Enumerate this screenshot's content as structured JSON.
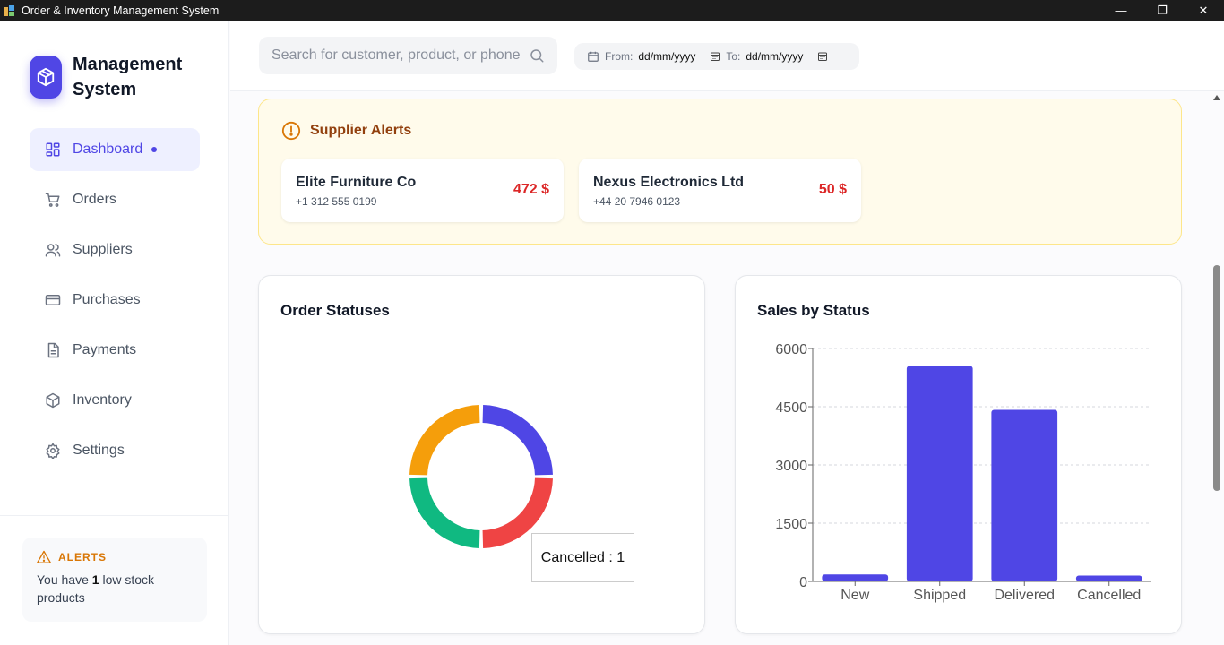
{
  "window": {
    "title": "Order & Inventory Management System",
    "controls": {
      "minimize": "—",
      "maximize": "❐",
      "close": "✕"
    }
  },
  "brand": {
    "name": "Management System",
    "icon": "box-icon"
  },
  "sidebar": {
    "items": [
      {
        "label": "Dashboard",
        "icon": "grid-icon",
        "active": true
      },
      {
        "label": "Orders",
        "icon": "cart-icon"
      },
      {
        "label": "Suppliers",
        "icon": "users-icon"
      },
      {
        "label": "Purchases",
        "icon": "card-icon"
      },
      {
        "label": "Payments",
        "icon": "document-icon"
      },
      {
        "label": "Inventory",
        "icon": "package-icon"
      },
      {
        "label": "Settings",
        "icon": "gear-icon"
      }
    ],
    "alerts": {
      "title": "ALERTS",
      "text_prefix": "You have",
      "count": "1",
      "text_suffix": "low stock products"
    }
  },
  "header": {
    "search_placeholder": "Search for customer, product, or phone",
    "date_from_label": "From:",
    "date_from_value": "dd/mm/yyyy",
    "date_to_label": "To:",
    "date_to_value": "dd/mm/yyyy"
  },
  "supplier_alerts": {
    "title": "Supplier Alerts",
    "cards": [
      {
        "name": "Elite Furniture Co",
        "phone": "+1 312 555 0199",
        "amount": "472 $"
      },
      {
        "name": "Nexus Electronics Ltd",
        "phone": "+44 20 7946 0123",
        "amount": "50 $"
      }
    ]
  },
  "order_statuses": {
    "title": "Order Statuses",
    "tooltip": "Cancelled : 1"
  },
  "sales_by_status": {
    "title": "Sales by Status"
  },
  "colors": {
    "accent": "#4f46e5",
    "new": "#4f46e5",
    "cancelled": "#ef4444",
    "delivered": "#10b981",
    "shipped": "#f59e0b",
    "bar": "#4f46e5"
  },
  "chart_data": [
    {
      "type": "pie",
      "title": "Order Statuses",
      "labels": [
        "",
        "Cancelled",
        "",
        ""
      ],
      "values": [
        1,
        1,
        1,
        1
      ],
      "colors": [
        "#4f46e5",
        "#ef4444",
        "#10b981",
        "#f59e0b"
      ]
    },
    {
      "type": "bar",
      "title": "Sales by Status",
      "categories": [
        "New",
        "Shipped",
        "Delivered",
        "Cancelled"
      ],
      "values": [
        180,
        5550,
        4420,
        150
      ],
      "ylim": [
        0,
        6000
      ],
      "yticks": [
        0,
        1500,
        3000,
        4500,
        6000
      ],
      "grid": true
    }
  ]
}
